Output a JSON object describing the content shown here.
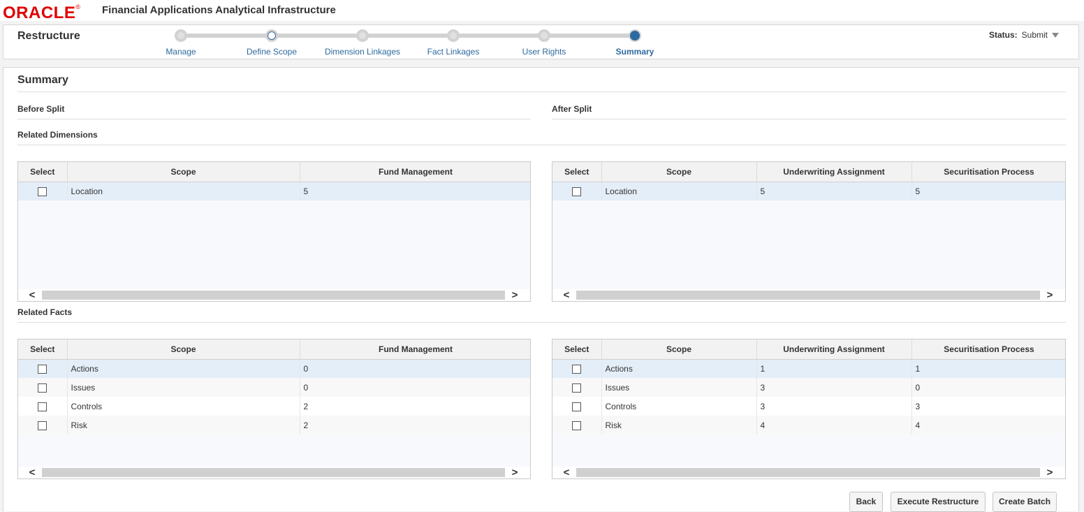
{
  "header": {
    "logo_text": "ORACLE",
    "app_title": "Financial Applications Analytical Infrastructure"
  },
  "train": {
    "title": "Restructure",
    "stops": [
      "Manage",
      "Define Scope",
      "Dimension Linkages",
      "Fact Linkages",
      "User Rights",
      "Summary"
    ],
    "current": "Summary",
    "status_label": "Status:",
    "status_value": "Submit"
  },
  "summary": {
    "title": "Summary",
    "before_split": "Before Split",
    "after_split": "After Split",
    "related_dimensions": "Related Dimensions",
    "related_facts": "Related Facts"
  },
  "dim_before": {
    "headers": [
      "Select",
      "Scope",
      "Fund Management"
    ],
    "rows": [
      {
        "scope": "Location",
        "fund": "5"
      }
    ]
  },
  "dim_after": {
    "headers": [
      "Select",
      "Scope",
      "Underwriting Assignment",
      "Securitisation Process"
    ],
    "rows": [
      {
        "scope": "Location",
        "uw": "5",
        "sec": "5"
      }
    ]
  },
  "fact_before": {
    "headers": [
      "Select",
      "Scope",
      "Fund Management"
    ],
    "rows": [
      {
        "scope": "Actions",
        "fund": "0"
      },
      {
        "scope": "Issues",
        "fund": "0"
      },
      {
        "scope": "Controls",
        "fund": "2"
      },
      {
        "scope": "Risk",
        "fund": "2"
      }
    ]
  },
  "fact_after": {
    "headers": [
      "Select",
      "Scope",
      "Underwriting Assignment",
      "Securitisation Process"
    ],
    "rows": [
      {
        "scope": "Actions",
        "uw": "1",
        "sec": "1"
      },
      {
        "scope": "Issues",
        "uw": "3",
        "sec": "0"
      },
      {
        "scope": "Controls",
        "uw": "3",
        "sec": "3"
      },
      {
        "scope": "Risk",
        "uw": "4",
        "sec": "4"
      }
    ]
  },
  "buttons": {
    "back": "Back",
    "execute": "Execute Restructure",
    "create_batch": "Create Batch"
  },
  "colors": {
    "brand_red": "#e00000",
    "accent_blue": "#2d6a9f",
    "selected_row": "#e4eef8"
  }
}
